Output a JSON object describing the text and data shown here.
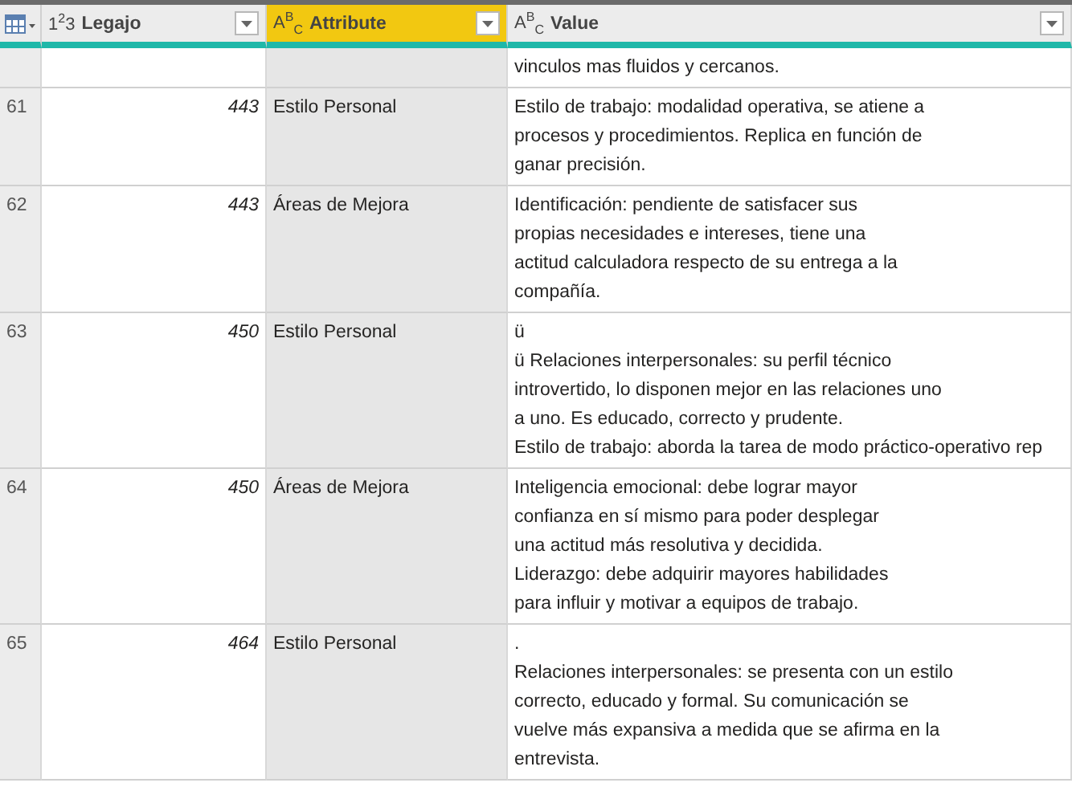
{
  "table": {
    "columns": [
      {
        "type_label": "1$^{2}$3",
        "label": "Legajo",
        "selected": false
      },
      {
        "type_label": "A$^{B}$$_{C}$",
        "label": "Attribute",
        "selected": true
      },
      {
        "type_label": "A$^{B}$$_{C}$",
        "label": "Value",
        "selected": false
      }
    ],
    "partial_row": {
      "value_lines": [
        "vinculos mas fluidos y cercanos."
      ]
    },
    "rows": [
      {
        "index": "61",
        "legajo": "443",
        "attribute": "Estilo Personal",
        "value_lines": [
          "Estilo de trabajo: modalidad operativa, se atiene a",
          "procesos y procedimientos. Replica en función de",
          "ganar precisión."
        ]
      },
      {
        "index": "62",
        "legajo": "443",
        "attribute": "Áreas de Mejora",
        "value_lines": [
          "Identificación: pendiente de satisfacer sus",
          "propias necesidades e intereses, tiene una",
          "actitud calculadora respecto de su entrega a la",
          "compañía."
        ]
      },
      {
        "index": "63",
        "legajo": "450",
        "attribute": "Estilo Personal",
        "value_lines": [
          "ü",
          "ü Relaciones interpersonales: su perfil técnico",
          "introvertido, lo disponen mejor en las relaciones uno",
          "a uno. Es educado, correcto y prudente.",
          "Estilo de trabajo: aborda la tarea de modo práctico-operativo rep"
        ]
      },
      {
        "index": "64",
        "legajo": "450",
        "attribute": "Áreas de Mejora",
        "value_lines": [
          "Inteligencia emocional: debe lograr mayor",
          "confianza en sí mismo para poder desplegar",
          "una actitud más resolutiva y decidida.",
          "Liderazgo: debe adquirir mayores habilidades",
          "para influir y motivar a equipos de trabajo."
        ]
      },
      {
        "index": "65",
        "legajo": "464",
        "attribute": "Estilo Personal",
        "value_lines": [
          ".",
          "Relaciones interpersonales: se presenta con un estilo",
          "correcto, educado y formal. Su comunicación se",
          "vuelve más expansiva a medida que se afirma en la",
          "entrevista."
        ]
      }
    ]
  }
}
